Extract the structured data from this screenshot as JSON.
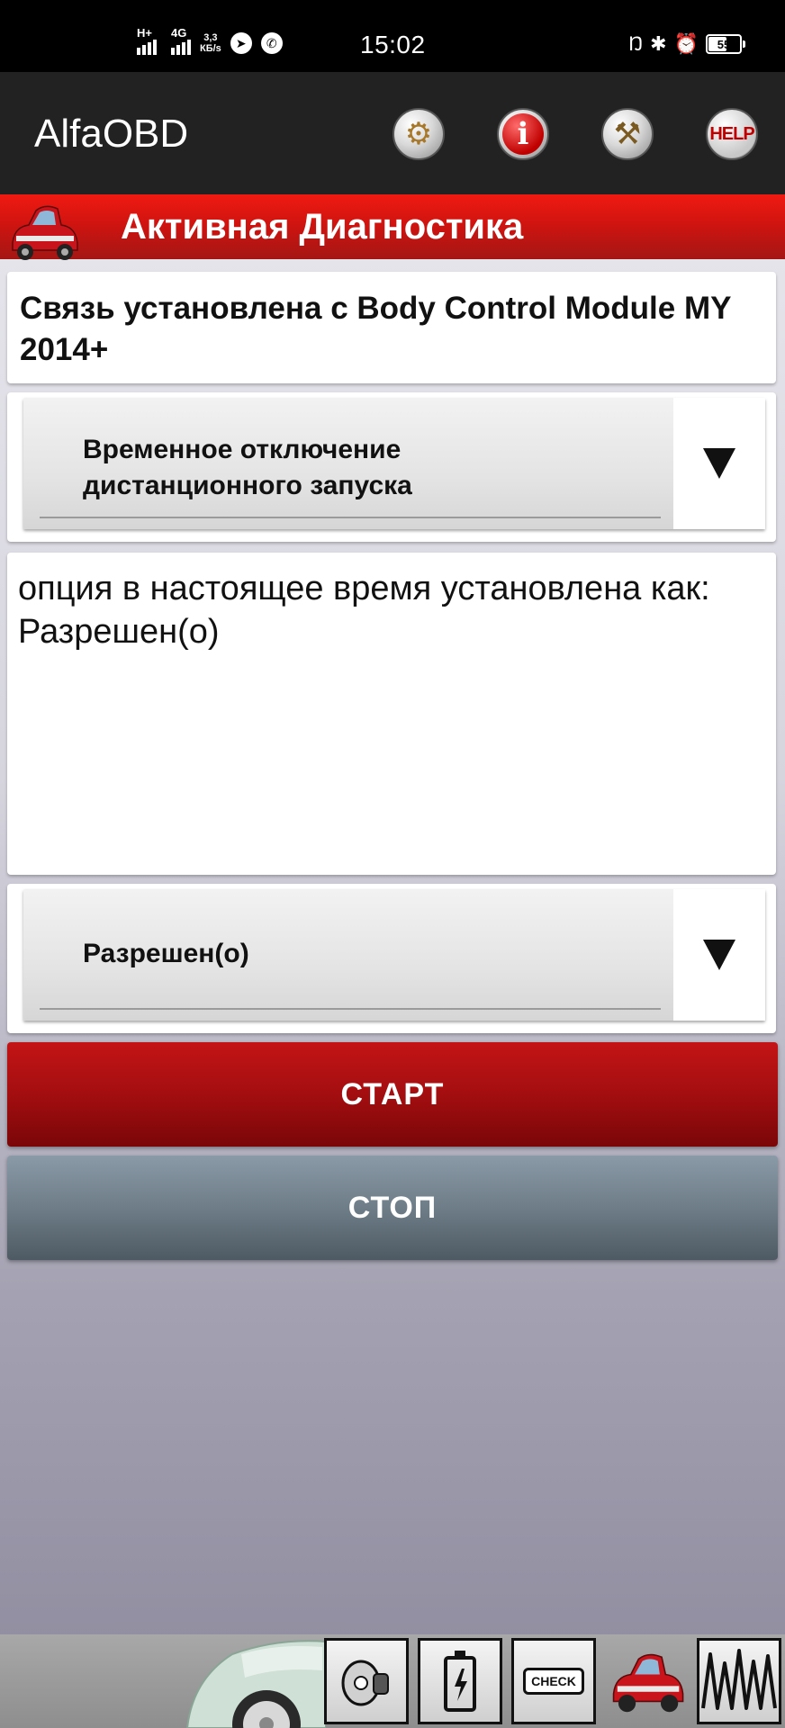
{
  "status_bar": {
    "net1": "H+",
    "net2": "4G",
    "speed_top": "3,3",
    "speed_bottom": "КБ/s",
    "time": "15:02",
    "battery": "55",
    "icons": [
      "telegram-icon",
      "viber-icon",
      "nfc-icon",
      "bluetooth-icon",
      "alarm-icon"
    ]
  },
  "app_bar": {
    "title": "AlfaOBD",
    "actions": [
      {
        "name": "settings",
        "icon": "gears-icon"
      },
      {
        "name": "info",
        "icon": "info-icon"
      },
      {
        "name": "tools",
        "icon": "tools-icon"
      },
      {
        "name": "help",
        "icon": "help-icon",
        "label": "HELP"
      }
    ]
  },
  "header": {
    "title": "Активная Диагностика"
  },
  "connection": {
    "text": " Связь установлена с Body Control Module MY 2014+"
  },
  "function_selector": {
    "selected_line1": "Временное отключение",
    "selected_line2": "дистанционного запуска"
  },
  "option_info": {
    "line1": "опция в настоящее время установлена как:",
    "line2": "Разрешен(о)"
  },
  "value_selector": {
    "selected": "Разрешен(о)"
  },
  "buttons": {
    "start": "СТАРТ",
    "stop": "СТОП"
  },
  "bottom_bar": {
    "check_label": "CHECK",
    "items": [
      "car-front-image",
      "ignition-key-icon",
      "battery-icon",
      "check-engine-icon",
      "car-hood-open-icon",
      "waveform-icon"
    ]
  },
  "colors": {
    "header_red": "#d01410",
    "app_bar": "#222222",
    "start": "#a30e10",
    "stop": "#6e7d88"
  }
}
